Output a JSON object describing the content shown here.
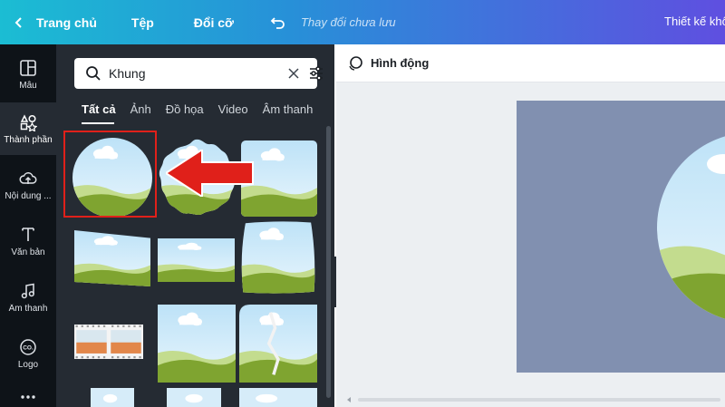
{
  "header": {
    "back_label": "Trang chủ",
    "file_menu": "Tệp",
    "resize_menu": "Đổi cỡ",
    "unsaved_text": "Thay đổi chưa lưu",
    "design_title": "Thiết kế khô",
    "icons": [
      "chevron-left-icon",
      "undo-icon"
    ]
  },
  "rail": {
    "items": [
      {
        "label": "Mẫu",
        "icon": "template-grid-icon"
      },
      {
        "label": "Thành phần",
        "icon": "elements-icon",
        "active": true
      },
      {
        "label": "Nội dung ...",
        "icon": "cloud-upload-icon"
      },
      {
        "label": "Văn bản",
        "icon": "text-t-icon"
      },
      {
        "label": "Âm thanh",
        "icon": "music-note-icon"
      },
      {
        "label": "Logo",
        "icon": "logo-badge-icon"
      },
      {
        "label": "",
        "icon": "more-dots-icon"
      }
    ]
  },
  "panel": {
    "search": {
      "value": "Khung",
      "icons": [
        "search-icon",
        "clear-icon",
        "filter-sliders-icon"
      ]
    },
    "tabs": [
      "Tất cả",
      "Ảnh",
      "Đồ họa",
      "Video",
      "Âm thanh"
    ],
    "active_tab": "Tất cả",
    "highlight_color": "#e0201a",
    "arrow_color": "#e0201a"
  },
  "canvas": {
    "animate_label": "Hình động",
    "page_color": "#8190b0"
  }
}
